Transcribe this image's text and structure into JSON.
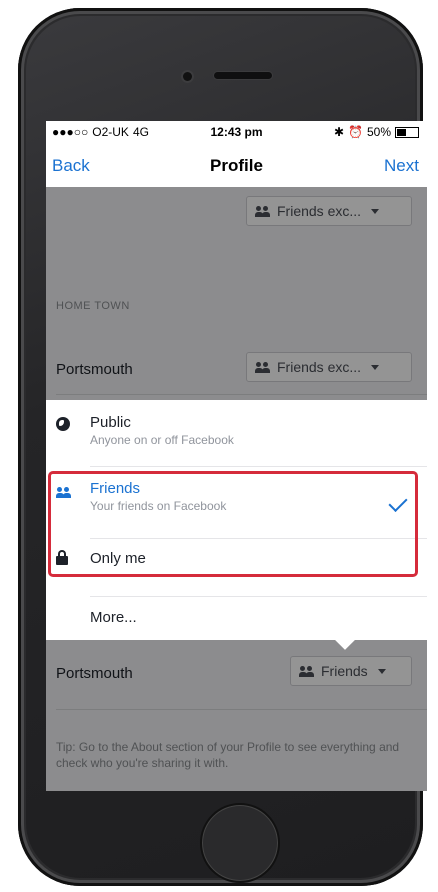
{
  "status_bar": {
    "signal": "●●●○○",
    "carrier": "O2-UK",
    "network": "4G",
    "time": "12:43 pm",
    "bluetooth": "✱",
    "alarm": "⏰",
    "battery_text": "50%",
    "battery_level": 0.5
  },
  "navbar": {
    "back": "Back",
    "title": "Profile",
    "next": "Next"
  },
  "top_privacy": {
    "label": "Friends exc..."
  },
  "home_town": {
    "section_label": "HOME TOWN",
    "value": "Portsmouth",
    "privacy_label": "Friends exc..."
  },
  "lower_row": {
    "value": "Portsmouth",
    "privacy_label": "Friends"
  },
  "tip": "Tip: Go to the About section of your Profile to see everything and check who you're sharing it with.",
  "menu": {
    "options": [
      {
        "title": "Public",
        "subtitle": "Anyone on or off Facebook",
        "icon": "globe-icon"
      },
      {
        "title": "Friends",
        "subtitle": "Your friends on Facebook",
        "icon": "friends-icon",
        "selected": true
      },
      {
        "title": "Only me",
        "subtitle": "",
        "icon": "lock-icon"
      },
      {
        "title": "More...",
        "subtitle": "",
        "icon": ""
      }
    ]
  },
  "colors": {
    "accent": "#1b72d1",
    "highlight": "#d52b3b",
    "background": "#f1f1f4"
  }
}
